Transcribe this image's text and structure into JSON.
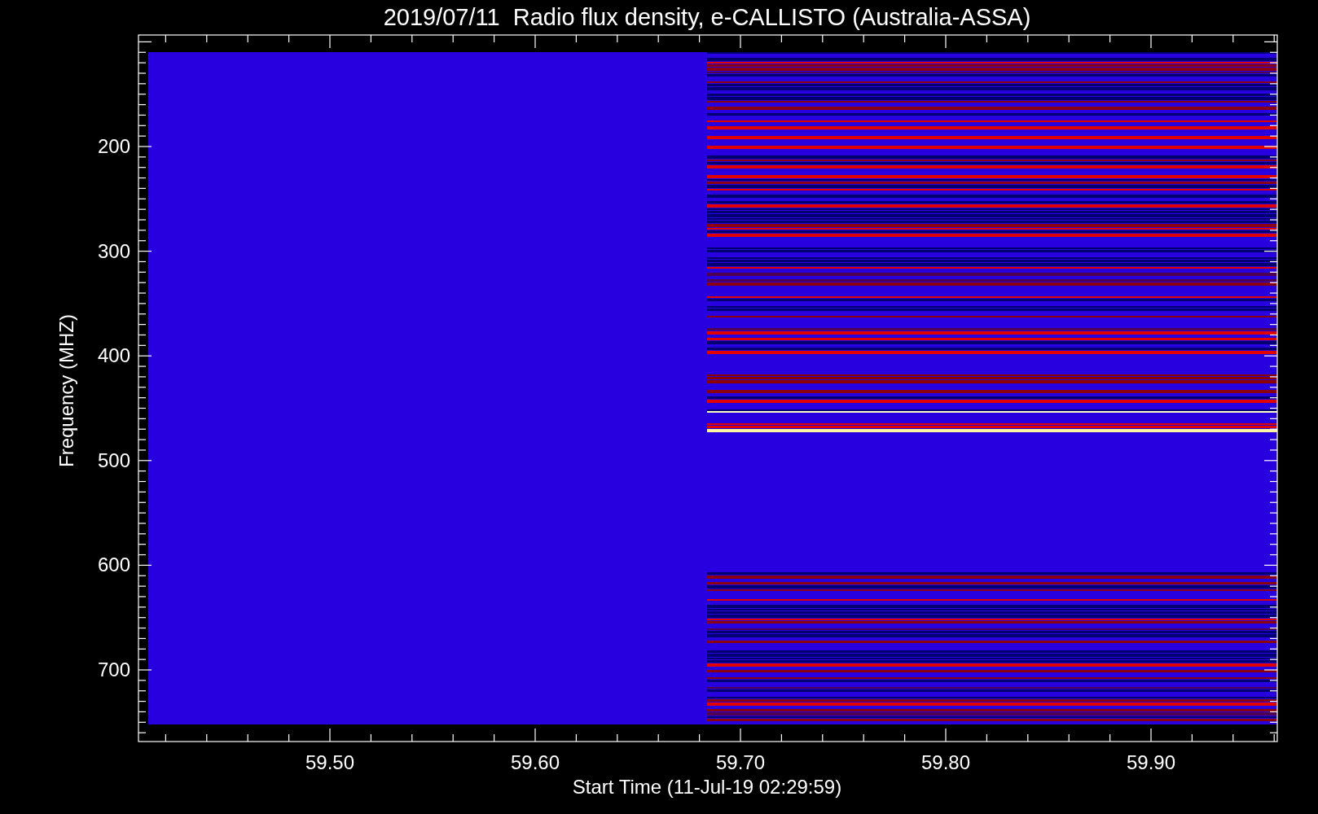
{
  "chart": {
    "title": "2019/07/11  Radio flux density, e-CALLISTO (Australia-ASSA)",
    "xlabel": "Start Time (11-Jul-19 02:29:59)",
    "ylabel": "Frequency (MHZ)",
    "xticks": [
      "59.50",
      "59.60",
      "59.70",
      "59.80",
      "59.90"
    ],
    "yticks": [
      "200",
      "300",
      "400",
      "500",
      "600",
      "700"
    ]
  }
}
